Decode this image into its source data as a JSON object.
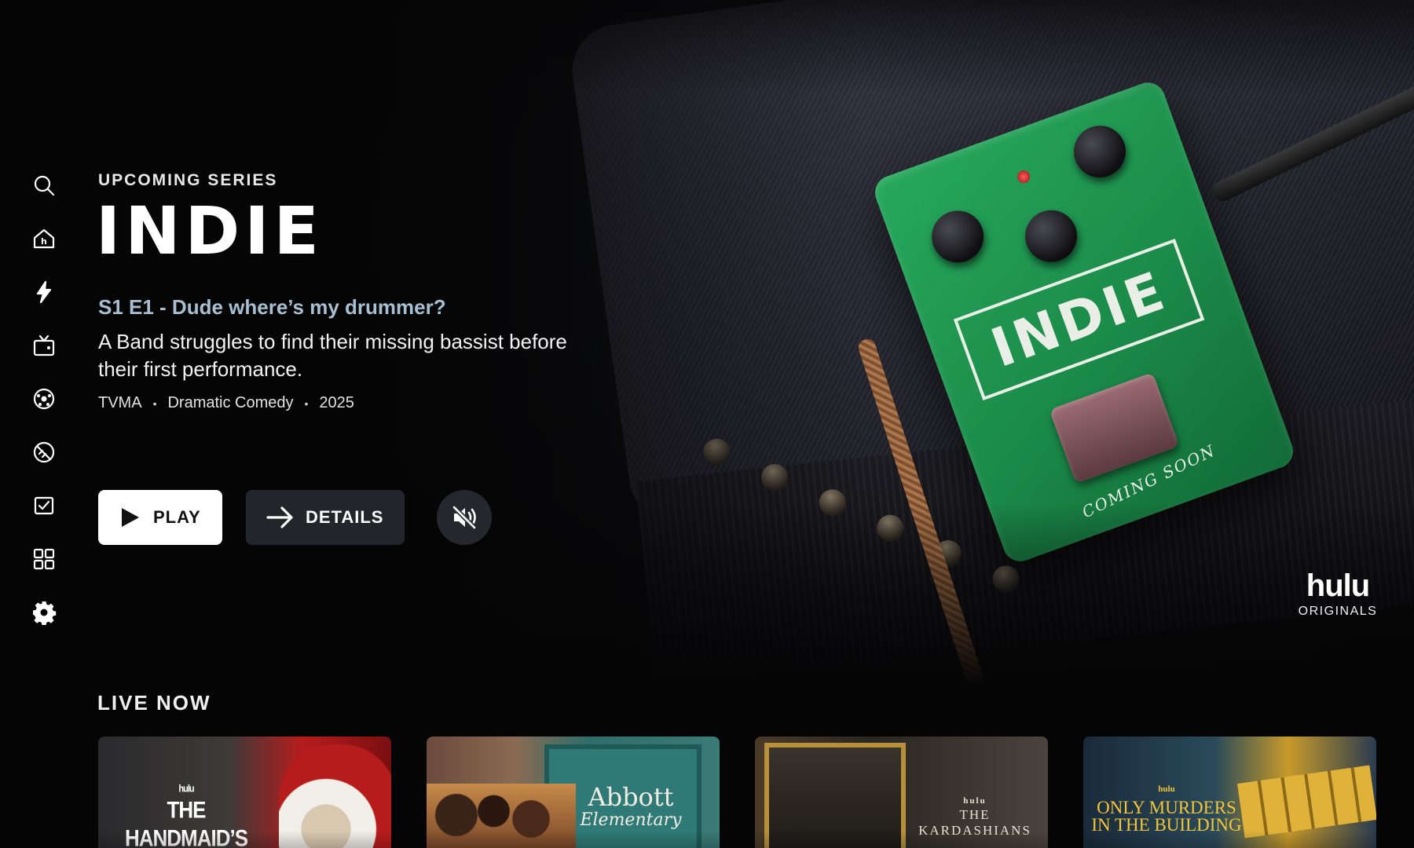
{
  "hero": {
    "eyebrow": "UPCOMING SERIES",
    "title": "INDIE",
    "episode": "S1 E1 - Dude where’s my drummer?",
    "synopsis": "A Band struggles to find their missing bassist before their first performance.",
    "rating": "TVMA",
    "genre": "Dramatic Comedy",
    "year": "2025",
    "meta_separator": "•",
    "pedal_label": "INDIE",
    "pedal_caption": "COMING SOON",
    "brand_name": "hulu",
    "brand_sub": "ORIGINALS"
  },
  "actions": {
    "play_label": "PLAY",
    "details_label": "DETAILS",
    "mute_icon": "muted-speaker-icon"
  },
  "sidebar": {
    "items": [
      {
        "name": "search",
        "icon": "search-icon"
      },
      {
        "name": "home",
        "icon": "home-icon"
      },
      {
        "name": "new",
        "icon": "lightning-icon"
      },
      {
        "name": "live-tv",
        "icon": "tv-icon"
      },
      {
        "name": "sports",
        "icon": "soccer-ball-icon"
      },
      {
        "name": "sports-alt",
        "icon": "football-icon"
      },
      {
        "name": "my-stuff",
        "icon": "checkbox-icon"
      },
      {
        "name": "hubs",
        "icon": "grid-icon"
      },
      {
        "name": "settings",
        "icon": "gear-icon"
      }
    ]
  },
  "live_now": {
    "title": "LIVE NOW",
    "cards": [
      {
        "brand": "hulu",
        "title": "THE HANDMAID’S TALE"
      },
      {
        "title": "Abbott",
        "subtitle": "Elementary"
      },
      {
        "brand": "hulu",
        "title": "THE KARDASHIANS"
      },
      {
        "brand": "hulu",
        "title": "ONLY MURDERS IN THE BUILDING"
      }
    ]
  },
  "colors": {
    "background": "#050506",
    "episode_accent": "#a7bfd1",
    "pedal_green": "#1b8b49",
    "button_primary": "#ffffff",
    "button_secondary": "#2d3037"
  }
}
